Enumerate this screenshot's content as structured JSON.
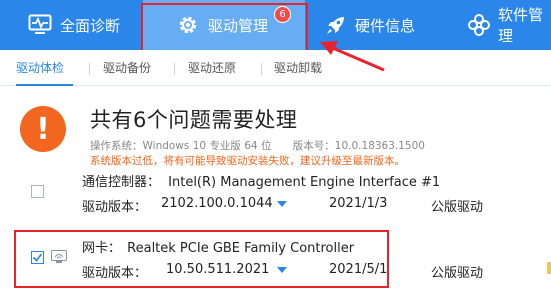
{
  "nav": {
    "items": [
      {
        "label": "全面诊断",
        "icon": "monitor-pulse-icon"
      },
      {
        "label": "驱动管理",
        "icon": "gear-icon",
        "badge": "6"
      },
      {
        "label": "硬件信息",
        "icon": "rocket-icon"
      },
      {
        "label": "软件管理",
        "icon": "apps-flower-icon"
      }
    ],
    "active_index": 1
  },
  "subtabs": {
    "items": [
      "驱动体检",
      "驱动备份",
      "驱动还原",
      "驱动卸载"
    ],
    "active_index": 0
  },
  "summary": {
    "headline": "共有6个问题需要处理",
    "os_label": "操作系统：Windows 10 专业版 64 位",
    "version_label": "版本号：10.0.18363.1500",
    "warning": "系统版本过低，将有可能导致驱动安装失败，建议升级至最新版本。"
  },
  "devices": [
    {
      "category": "通信控制器：",
      "name": "Intel(R) Management Engine Interface #1",
      "version_label": "驱动版本：",
      "version": "2102.100.0.1044",
      "date": "2021/1/3",
      "type": "公版驱动",
      "checked": false
    },
    {
      "category": "网卡：",
      "name": "Realtek PCIe GBE Family Controller",
      "version_label": "驱动版本：",
      "version": "10.50.511.2021",
      "date": "2021/5/1",
      "type": "公版驱动",
      "checked": true
    }
  ],
  "colors": {
    "nav_bg": "#2a86e8",
    "nav_active": "#66adf4",
    "accent": "#2a86e8",
    "warning": "#f2661f",
    "annotation_red": "#e8232b"
  }
}
